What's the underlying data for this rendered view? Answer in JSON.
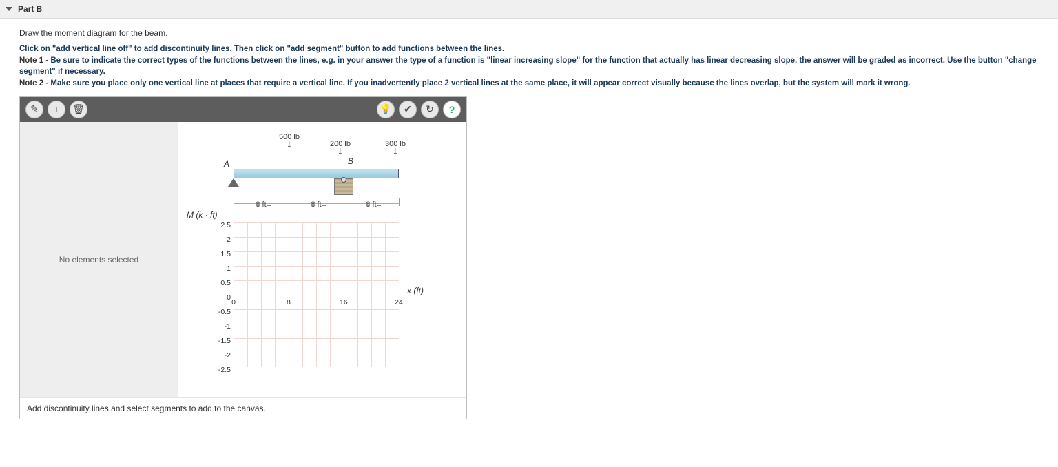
{
  "header": {
    "title": "Part B"
  },
  "prompt": "Draw the moment diagram for the beam.",
  "instructions": {
    "line1": "Click on \"add vertical line off\" to add discontinuity lines. Then click on \"add segment\" button to add functions between the lines.",
    "note1_label": "Note 1 - ",
    "note1": "Be sure to indicate the correct types of the functions between the lines, e.g. in your answer the type of a function is \"linear increasing slope\" for the function that actually has linear decreasing slope, the answer will be graded as incorrect. Use the button \"change segment\" if necessary.",
    "note2_label": "Note 2 - ",
    "note2": "Make sure you place only one vertical line at places that require a vertical line. If you inadvertently place 2 vertical lines at the same place, it will appear correct visually because the lines overlap, but the system will mark it wrong."
  },
  "sidepane": {
    "empty": "No elements selected"
  },
  "statusbar": "Add discontinuity lines and select segments to add to the canvas.",
  "beam": {
    "pointA": "A",
    "pointB": "B",
    "loads": [
      {
        "label": "500 lb"
      },
      {
        "label": "200 lb"
      },
      {
        "label": "300 lb"
      }
    ],
    "dims": [
      "8 ft",
      "8 ft",
      "8 ft"
    ]
  },
  "chart_data": {
    "type": "line",
    "title": "",
    "ylabel": "M (k · ft)",
    "xlabel": "x (ft)",
    "xlim": [
      0,
      24
    ],
    "ylim": [
      -2.5,
      2.5
    ],
    "xticks": [
      0,
      8,
      16,
      24
    ],
    "yticks": [
      2.5,
      2.0,
      1.5,
      1.0,
      0.5,
      0.0,
      -0.5,
      -1.0,
      -1.5,
      -2.0,
      -2.5
    ],
    "series": []
  },
  "toolbar_icons": {
    "draw": "✎",
    "add": "+",
    "delete": "🗑",
    "hint": "💡",
    "check": "✔",
    "reset": "↻",
    "help": "?"
  }
}
